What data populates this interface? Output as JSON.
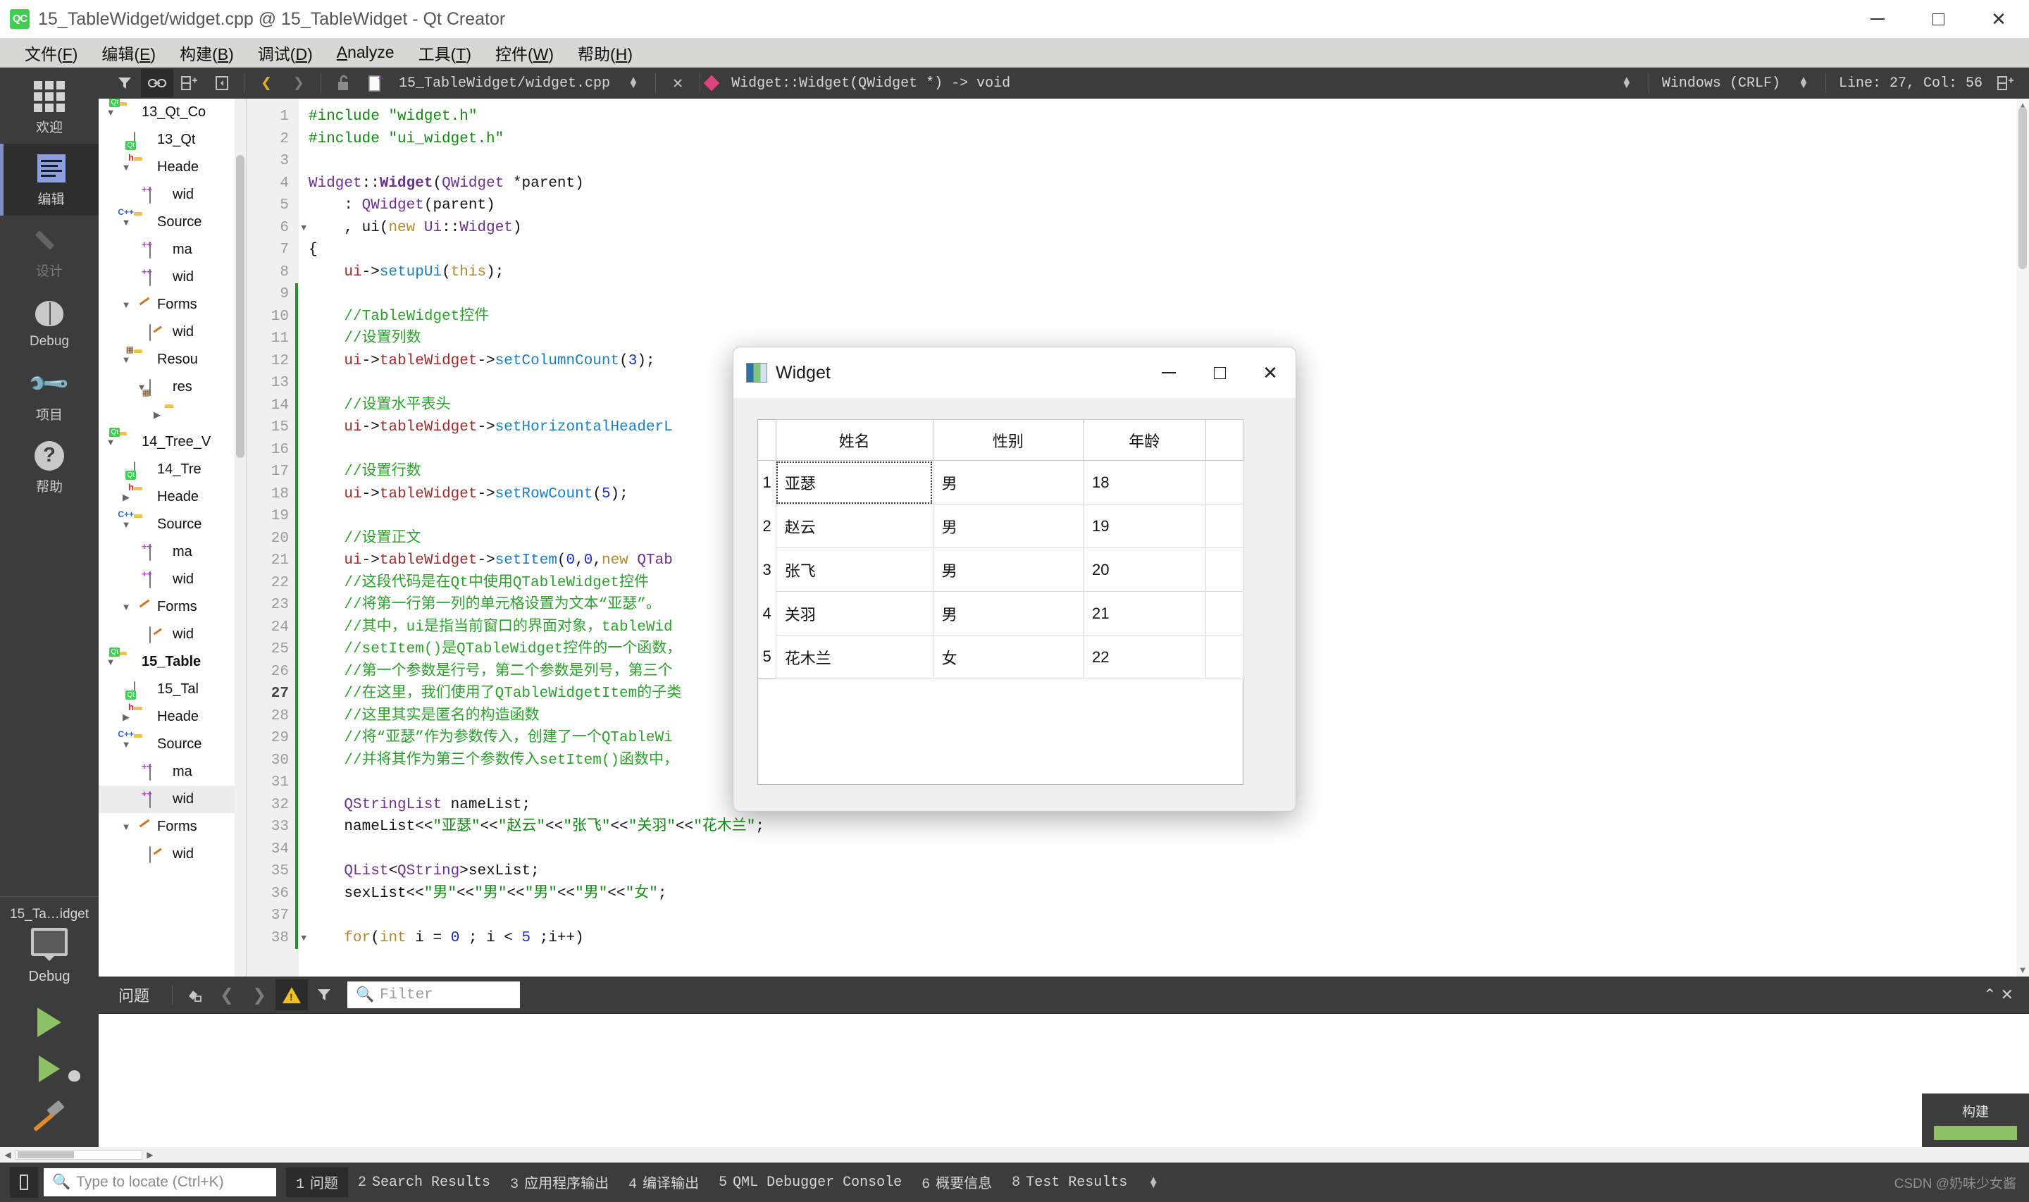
{
  "window": {
    "title": "15_TableWidget/widget.cpp @ 15_TableWidget - Qt Creator",
    "logo": "QC",
    "minimize": "minimize-icon",
    "maximize": "maximize-icon",
    "close": "close-icon"
  },
  "menu": [
    {
      "pre": "文件(",
      "key": "F",
      "post": ")"
    },
    {
      "pre": "编辑(",
      "key": "E",
      "post": ")"
    },
    {
      "pre": "构建(",
      "key": "B",
      "post": ")"
    },
    {
      "pre": "调试(",
      "key": "D",
      "post": ")"
    },
    {
      "pre": "",
      "key": "A",
      "post": "nalyze"
    },
    {
      "pre": "工具(",
      "key": "T",
      "post": ")"
    },
    {
      "pre": "控件(",
      "key": "W",
      "post": ")"
    },
    {
      "pre": "帮助(",
      "key": "H",
      "post": ")"
    }
  ],
  "modebar": {
    "items": [
      {
        "label": "欢迎",
        "icon": "grid-icon",
        "state": "normal"
      },
      {
        "label": "编辑",
        "icon": "edit-lines-icon",
        "state": "active"
      },
      {
        "label": "设计",
        "icon": "pencil-icon",
        "state": "disabled"
      },
      {
        "label": "Debug",
        "icon": "bug-icon",
        "state": "normal"
      },
      {
        "label": "项目",
        "icon": "wrench-icon",
        "state": "normal"
      },
      {
        "label": "帮助",
        "icon": "question-mark-icon",
        "state": "normal"
      }
    ],
    "kit": {
      "project": "15_Ta…idget",
      "mode": "Debug",
      "monitor_icon": "monitor-icon",
      "expand_icon": "chevron-right-icon",
      "run_icon": "run-play-icon",
      "debug_icon": "run-debug-icon",
      "build_icon": "build-hammer-icon"
    }
  },
  "editor_toolbar": {
    "filter_icon": "filter-icon",
    "link_icon": "link-editors-icon",
    "split_icon": "split-horizontal-icon",
    "close_split_icon": "close-split-icon",
    "back_icon": "back-chevron-icon",
    "forward_icon": "forward-chevron-icon",
    "lock_icon": "unlocked-padlock-icon",
    "file_icon": "cpp-file-icon",
    "filename": "15_TableWidget/widget.cpp",
    "file_dropdown_icon": "spin-updown-icon",
    "close_file_icon": "close-icon",
    "symbol_marker": "pink-diamond-icon",
    "symbol": "Widget::Widget(QWidget *) -> void",
    "symbol_dropdown_icon": "spin-updown-icon",
    "line_ending": "Windows (CRLF)",
    "line_ending_dropdown_icon": "spin-updown-icon",
    "cursor_position": "Line: 27, Col: 56",
    "split_right_icon": "split-horizontal-icon"
  },
  "tree": {
    "scrollbar": "vertical-scrollbar",
    "nodes": [
      {
        "indent": 0,
        "arrow": "▼",
        "icon": "folder-qt",
        "label": "13_Qt_Co",
        "selected": false,
        "bold": false
      },
      {
        "indent": 1,
        "arrow": "",
        "icon": "file-qt",
        "label": "13_Qt",
        "selected": false,
        "bold": false
      },
      {
        "indent": 1,
        "arrow": "▼",
        "icon": "folder-h",
        "label": "Heade",
        "selected": false,
        "bold": false
      },
      {
        "indent": 2,
        "arrow": "",
        "icon": "file-h",
        "label": "wid",
        "selected": false,
        "bold": false
      },
      {
        "indent": 1,
        "arrow": "▼",
        "icon": "folder-cpp",
        "label": "Source",
        "selected": false,
        "bold": false
      },
      {
        "indent": 2,
        "arrow": "",
        "icon": "file-cpp",
        "label": "ma",
        "selected": false,
        "bold": false
      },
      {
        "indent": 2,
        "arrow": "",
        "icon": "file-cpp",
        "label": "wid",
        "selected": false,
        "bold": false
      },
      {
        "indent": 1,
        "arrow": "▼",
        "icon": "folder-ui",
        "label": "Forms",
        "selected": false,
        "bold": false
      },
      {
        "indent": 2,
        "arrow": "",
        "icon": "file-ui",
        "label": "wid",
        "selected": false,
        "bold": false
      },
      {
        "indent": 1,
        "arrow": "▼",
        "icon": "folder-res",
        "label": "Resou",
        "selected": false,
        "bold": false
      },
      {
        "indent": 2,
        "arrow": "▼",
        "icon": "file-res",
        "label": "res",
        "selected": false,
        "bold": false
      },
      {
        "indent": 3,
        "arrow": "▶",
        "icon": "folder",
        "label": "",
        "selected": false,
        "bold": false
      },
      {
        "indent": 0,
        "arrow": "▼",
        "icon": "folder-qt",
        "label": "14_Tree_V",
        "selected": false,
        "bold": false
      },
      {
        "indent": 1,
        "arrow": "",
        "icon": "file-qt",
        "label": "14_Tre",
        "selected": false,
        "bold": false
      },
      {
        "indent": 1,
        "arrow": "▶",
        "icon": "folder-h",
        "label": "Heade",
        "selected": false,
        "bold": false
      },
      {
        "indent": 1,
        "arrow": "▼",
        "icon": "folder-cpp",
        "label": "Source",
        "selected": false,
        "bold": false
      },
      {
        "indent": 2,
        "arrow": "",
        "icon": "file-cpp",
        "label": "ma",
        "selected": false,
        "bold": false
      },
      {
        "indent": 2,
        "arrow": "",
        "icon": "file-cpp",
        "label": "wid",
        "selected": false,
        "bold": false
      },
      {
        "indent": 1,
        "arrow": "▼",
        "icon": "folder-ui",
        "label": "Forms",
        "selected": false,
        "bold": false
      },
      {
        "indent": 2,
        "arrow": "",
        "icon": "file-ui",
        "label": "wid",
        "selected": false,
        "bold": false
      },
      {
        "indent": 0,
        "arrow": "▼",
        "icon": "folder-qt",
        "label": "15_Table",
        "selected": false,
        "bold": true
      },
      {
        "indent": 1,
        "arrow": "",
        "icon": "file-qt",
        "label": "15_Tal",
        "selected": false,
        "bold": false
      },
      {
        "indent": 1,
        "arrow": "▶",
        "icon": "folder-h",
        "label": "Heade",
        "selected": false,
        "bold": false
      },
      {
        "indent": 1,
        "arrow": "▼",
        "icon": "folder-cpp",
        "label": "Source",
        "selected": false,
        "bold": false
      },
      {
        "indent": 2,
        "arrow": "",
        "icon": "file-cpp",
        "label": "ma",
        "selected": false,
        "bold": false
      },
      {
        "indent": 2,
        "arrow": "",
        "icon": "file-cpp",
        "label": "wid",
        "selected": true,
        "bold": false
      },
      {
        "indent": 1,
        "arrow": "▼",
        "icon": "folder-ui",
        "label": "Forms",
        "selected": false,
        "bold": false
      },
      {
        "indent": 2,
        "arrow": "",
        "icon": "file-ui",
        "label": "wid",
        "selected": false,
        "bold": false
      }
    ]
  },
  "code": {
    "current_line": 27,
    "fold_lines": [
      6,
      38
    ],
    "change_from": 9,
    "change_to": 38,
    "lines": [
      {
        "n": 1,
        "html": "<span class=\"k-pre\">#include</span> <span class=\"k-str\">\"widget.h\"</span>"
      },
      {
        "n": 2,
        "html": "<span class=\"k-pre\">#include</span> <span class=\"k-str\">\"ui_widget.h\"</span>"
      },
      {
        "n": 3,
        "html": ""
      },
      {
        "n": 4,
        "html": "<span class=\"k-cls\">Widget</span><span class=\"k-pl\">::</span><span class=\"k-cls k-bold\">Widget</span><span class=\"k-pl\">(</span><span class=\"k-cls\">QWidget</span> <span class=\"k-pl\">*parent)</span>"
      },
      {
        "n": 5,
        "html": "    <span class=\"k-pl\">: </span><span class=\"k-cls\">QWidget</span><span class=\"k-pl\">(parent)</span>"
      },
      {
        "n": 6,
        "html": "    <span class=\"k-pl\">, ui(</span><span class=\"k-par\">new</span> <span class=\"k-cls\">Ui</span><span class=\"k-pl\">::</span><span class=\"k-cls\">Widget</span><span class=\"k-pl\">)</span>"
      },
      {
        "n": 7,
        "html": "<span class=\"k-pl\">{</span>"
      },
      {
        "n": 8,
        "html": "    <span class=\"k-var\">ui</span><span class=\"k-pl\">-&gt;</span><span class=\"k-fn\">setupUi</span><span class=\"k-pl\">(</span><span class=\"k-par\">this</span><span class=\"k-pl\">);</span>"
      },
      {
        "n": 9,
        "html": ""
      },
      {
        "n": 10,
        "html": "    <span class=\"k-cmt\">//TableWidget控件</span>"
      },
      {
        "n": 11,
        "html": "    <span class=\"k-cmt\">//设置列数</span>"
      },
      {
        "n": 12,
        "html": "    <span class=\"k-var\">ui</span><span class=\"k-pl\">-&gt;</span><span class=\"k-var\">tableWidget</span><span class=\"k-pl\">-&gt;</span><span class=\"k-fn\">setColumnCount</span><span class=\"k-pl\">(</span><span class=\"k-num\">3</span><span class=\"k-pl\">);</span>"
      },
      {
        "n": 13,
        "html": ""
      },
      {
        "n": 14,
        "html": "    <span class=\"k-cmt\">//设置水平表头</span>"
      },
      {
        "n": 15,
        "html": "    <span class=\"k-var\">ui</span><span class=\"k-pl\">-&gt;</span><span class=\"k-var\">tableWidget</span><span class=\"k-pl\">-&gt;</span><span class=\"k-fn\">setHorizontalHeaderL</span>"
      },
      {
        "n": 16,
        "html": ""
      },
      {
        "n": 17,
        "html": "    <span class=\"k-cmt\">//设置行数</span>"
      },
      {
        "n": 18,
        "html": "    <span class=\"k-var\">ui</span><span class=\"k-pl\">-&gt;</span><span class=\"k-var\">tableWidget</span><span class=\"k-pl\">-&gt;</span><span class=\"k-fn\">setRowCount</span><span class=\"k-pl\">(</span><span class=\"k-num\">5</span><span class=\"k-pl\">);</span>"
      },
      {
        "n": 19,
        "html": ""
      },
      {
        "n": 20,
        "html": "    <span class=\"k-cmt\">//设置正文</span>"
      },
      {
        "n": 21,
        "html": "    <span class=\"k-var\">ui</span><span class=\"k-pl\">-&gt;</span><span class=\"k-var\">tableWidget</span><span class=\"k-pl\">-&gt;</span><span class=\"k-fn\">setItem</span><span class=\"k-pl\">(</span><span class=\"k-num\">0</span><span class=\"k-pl\">,</span><span class=\"k-num\">0</span><span class=\"k-pl\">,</span><span class=\"k-par\">new</span> <span class=\"k-cls\">QTab</span>"
      },
      {
        "n": 22,
        "html": "    <span class=\"k-cmt\">//这段代码是在Qt中使用QTableWidget控件</span>"
      },
      {
        "n": 23,
        "html": "    <span class=\"k-cmt\">//将第一行第一列的单元格设置为文本“亚瑟”。</span>"
      },
      {
        "n": 24,
        "html": "    <span class=\"k-cmt\">//其中，ui是指当前窗口的界面对象，tableWid</span>"
      },
      {
        "n": 25,
        "html": "    <span class=\"k-cmt\">//setItem()是QTableWidget控件的一个函数，</span>"
      },
      {
        "n": 26,
        "html": "    <span class=\"k-cmt\">//第一个参数是行号，第二个参数是列号，第三个</span>"
      },
      {
        "n": 27,
        "html": "    <span class=\"k-cmt\">//在这里，我们使用了QTableWidgetItem的子类</span>"
      },
      {
        "n": 28,
        "html": "    <span class=\"k-cmt\">//这里其实是匿名的构造函数</span>"
      },
      {
        "n": 29,
        "html": "    <span class=\"k-cmt\">//将“亚瑟”作为参数传入，创建了一个QTableWi</span>"
      },
      {
        "n": 30,
        "html": "    <span class=\"k-cmt\">//并将其作为第三个参数传入setItem()函数中，</span>"
      },
      {
        "n": 31,
        "html": ""
      },
      {
        "n": 32,
        "html": "    <span class=\"k-cls\">QStringList</span> <span class=\"k-pl\">nameList;</span>"
      },
      {
        "n": 33,
        "html": "    <span class=\"k-pl\">nameList&lt;&lt;</span><span class=\"k-str\">\"亚瑟\"</span><span class=\"k-pl\">&lt;&lt;</span><span class=\"k-str\">\"赵云\"</span><span class=\"k-pl\">&lt;&lt;</span><span class=\"k-str\">\"张飞\"</span><span class=\"k-pl\">&lt;&lt;</span><span class=\"k-str\">\"关羽\"</span><span class=\"k-pl\">&lt;&lt;</span><span class=\"k-str\">\"花木兰\"</span><span class=\"k-pl\">;</span>"
      },
      {
        "n": 34,
        "html": ""
      },
      {
        "n": 35,
        "html": "    <span class=\"k-cls\">QList</span><span class=\"k-pl\">&lt;</span><span class=\"k-cls\">QString</span><span class=\"k-pl\">&gt;sexList;</span>"
      },
      {
        "n": 36,
        "html": "    <span class=\"k-pl\">sexList&lt;&lt;</span><span class=\"k-str\">\"男\"</span><span class=\"k-pl\">&lt;&lt;</span><span class=\"k-str\">\"男\"</span><span class=\"k-pl\">&lt;&lt;</span><span class=\"k-str\">\"男\"</span><span class=\"k-pl\">&lt;&lt;</span><span class=\"k-str\">\"男\"</span><span class=\"k-pl\">&lt;&lt;</span><span class=\"k-str\">\"女\"</span><span class=\"k-pl\">;</span>"
      },
      {
        "n": 37,
        "html": ""
      },
      {
        "n": 38,
        "html": "    <span class=\"k-par\">for</span><span class=\"k-pl\">(</span><span class=\"k-par\">int</span> <span class=\"k-pl\">i = </span><span class=\"k-num\">0</span><span class=\"k-pl\"> ; i &lt; </span><span class=\"k-num\">5</span><span class=\"k-pl\"> ;i++)</span>"
      }
    ]
  },
  "qt_dialog": {
    "title": "Widget",
    "app_icon": "qt-widget-icon",
    "minimize": "minimize-icon",
    "maximize": "maximize-icon",
    "close": "close-icon",
    "table": {
      "headers": [
        "姓名",
        "性别",
        "年龄"
      ],
      "rows": [
        {
          "num": "1",
          "cells": [
            "亚瑟",
            "男",
            "18"
          ],
          "selected_col": 0
        },
        {
          "num": "2",
          "cells": [
            "赵云",
            "男",
            "19"
          ],
          "selected_col": -1
        },
        {
          "num": "3",
          "cells": [
            "张飞",
            "男",
            "20"
          ],
          "selected_col": -1
        },
        {
          "num": "4",
          "cells": [
            "关羽",
            "男",
            "21"
          ],
          "selected_col": -1
        },
        {
          "num": "5",
          "cells": [
            "花木兰",
            "女",
            "22"
          ],
          "selected_col": -1
        }
      ]
    }
  },
  "issues_panel": {
    "title": "问题",
    "clear_icon": "clear-pane-icon",
    "prev_icon": "previous-item-icon",
    "next_icon": "next-item-icon",
    "warning_icon": "warning-triangle-icon",
    "filter_icon": "filter-funnel-icon",
    "search_icon": "search-icon",
    "filter_placeholder": "Filter",
    "maximize_icon": "maximize-pane-icon",
    "close_icon": "close-pane-icon"
  },
  "build_progress": {
    "label": "构建",
    "color": "#8cc265",
    "percent": 100
  },
  "status_bar": {
    "sidebar_toggle_icon": "toggle-sidebar-icon",
    "locator_icon": "search-icon",
    "locator_placeholder": "Type to locate (Ctrl+K)",
    "tabs": [
      {
        "num": "1",
        "label": "问题",
        "active": true
      },
      {
        "num": "2",
        "label": "Search Results",
        "active": false
      },
      {
        "num": "3",
        "label": "应用程序输出",
        "active": false
      },
      {
        "num": "4",
        "label": "编译输出",
        "active": false
      },
      {
        "num": "5",
        "label": "QML Debugger Console",
        "active": false
      },
      {
        "num": "6",
        "label": "概要信息",
        "active": false
      },
      {
        "num": "8",
        "label": "Test Results",
        "active": false
      }
    ],
    "more_icon": "spin-updown-icon",
    "watermark": "CSDN @奶味少女酱"
  }
}
